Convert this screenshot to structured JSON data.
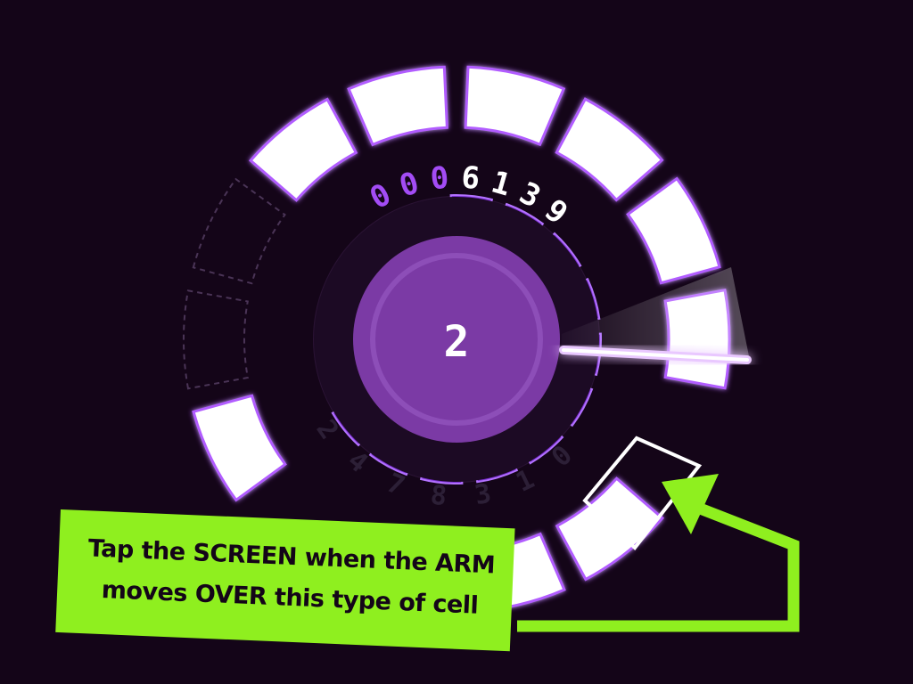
{
  "score": {
    "leading_zeros": [
      "0",
      "0",
      "0"
    ],
    "digits": [
      "6",
      "1",
      "3",
      "9"
    ]
  },
  "level": {
    "value": "2"
  },
  "sequence": {
    "digits": [
      "2",
      "4",
      "7",
      "8",
      "3",
      "1",
      "0"
    ]
  },
  "tip": {
    "line1": "Tap the SCREEN when the ARM",
    "line2": "moves OVER this type of cell"
  },
  "colors": {
    "background": "#140518",
    "cell": "#ffffff",
    "glow": "#b15cff",
    "accent_purple": "#9a3ff0",
    "center_purple": "#7b3aa5",
    "tip_green": "#8fef1f",
    "leading_zero": "#a34cf5"
  },
  "icons": {
    "arrow": "green-pointer-arrow-icon"
  }
}
